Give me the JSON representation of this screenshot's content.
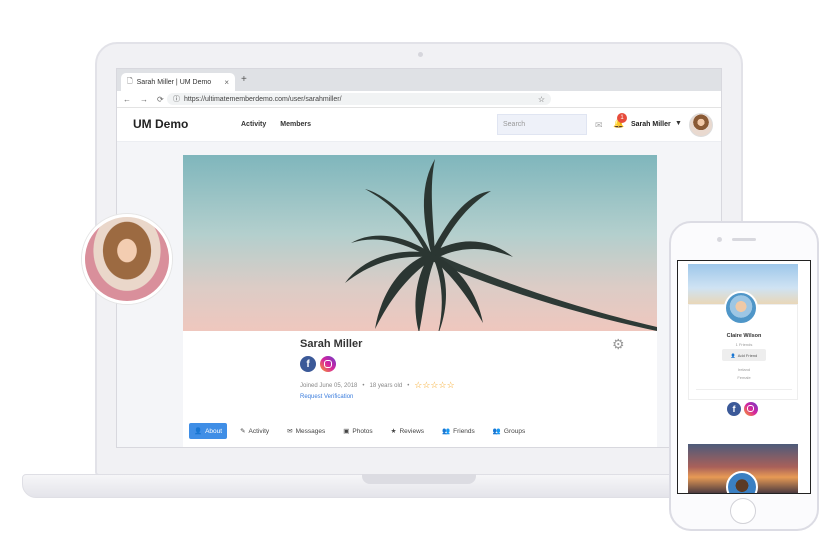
{
  "browser": {
    "tab_title": "Sarah Miller | UM Demo",
    "tab_close": "×",
    "new_tab": "+",
    "url": "https://ultimatememberdemo.com/user/sarahmiller/"
  },
  "site": {
    "logo": "UM Demo",
    "menu": [
      "Activity",
      "Members"
    ],
    "search_placeholder": "Search",
    "notification_count": "1",
    "user_name": "Sarah Miller"
  },
  "profile": {
    "name": "Sarah Miller",
    "joined": "Joined June 05, 2018",
    "separator": "•",
    "age": "18 years old",
    "rating_stars": "☆☆☆☆☆",
    "request_verification": "Request Verification",
    "tabs": [
      "About",
      "Activity",
      "Messages",
      "Photos",
      "Reviews",
      "Friends",
      "Groups"
    ],
    "active_tab": "About"
  },
  "mobile": {
    "name": "Claire Wilson",
    "followers": "1 Friends",
    "add_friend": "Add Friend",
    "line1": "Ireland",
    "line2": "Female"
  },
  "colors": {
    "accent": "#3f8ee6",
    "facebook": "#3b5998",
    "badge": "#e74c3c",
    "stars": "#f5a623"
  }
}
